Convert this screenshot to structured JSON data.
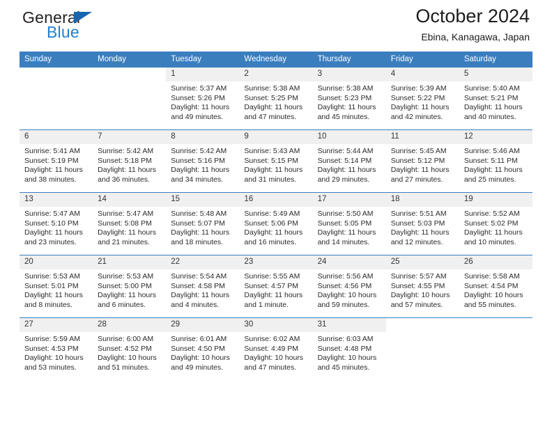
{
  "brand": {
    "name_top": "General",
    "name_bottom": "Blue",
    "triangle_color": "#1565b0",
    "blue_color": "#2081d2"
  },
  "header": {
    "title": "October 2024",
    "subtitle": "Ebina, Kanagawa, Japan"
  },
  "colors": {
    "header_row": "#3a7ebe",
    "day_band": "#f0f0f0",
    "text": "#2a2a2a"
  },
  "calendar": {
    "weekday_headers": [
      "Sunday",
      "Monday",
      "Tuesday",
      "Wednesday",
      "Thursday",
      "Friday",
      "Saturday"
    ],
    "labels": {
      "sunrise": "Sunrise:",
      "sunset": "Sunset:",
      "daylight": "Daylight:"
    },
    "weeks": [
      [
        {
          "day": "",
          "sunrise": "",
          "sunset": "",
          "daylight_line1": "",
          "daylight_line2": ""
        },
        {
          "day": "",
          "sunrise": "",
          "sunset": "",
          "daylight_line1": "",
          "daylight_line2": ""
        },
        {
          "day": "1",
          "sunrise": "Sunrise: 5:37 AM",
          "sunset": "Sunset: 5:26 PM",
          "daylight_line1": "Daylight: 11 hours",
          "daylight_line2": "and 49 minutes."
        },
        {
          "day": "2",
          "sunrise": "Sunrise: 5:38 AM",
          "sunset": "Sunset: 5:25 PM",
          "daylight_line1": "Daylight: 11 hours",
          "daylight_line2": "and 47 minutes."
        },
        {
          "day": "3",
          "sunrise": "Sunrise: 5:38 AM",
          "sunset": "Sunset: 5:23 PM",
          "daylight_line1": "Daylight: 11 hours",
          "daylight_line2": "and 45 minutes."
        },
        {
          "day": "4",
          "sunrise": "Sunrise: 5:39 AM",
          "sunset": "Sunset: 5:22 PM",
          "daylight_line1": "Daylight: 11 hours",
          "daylight_line2": "and 42 minutes."
        },
        {
          "day": "5",
          "sunrise": "Sunrise: 5:40 AM",
          "sunset": "Sunset: 5:21 PM",
          "daylight_line1": "Daylight: 11 hours",
          "daylight_line2": "and 40 minutes."
        }
      ],
      [
        {
          "day": "6",
          "sunrise": "Sunrise: 5:41 AM",
          "sunset": "Sunset: 5:19 PM",
          "daylight_line1": "Daylight: 11 hours",
          "daylight_line2": "and 38 minutes."
        },
        {
          "day": "7",
          "sunrise": "Sunrise: 5:42 AM",
          "sunset": "Sunset: 5:18 PM",
          "daylight_line1": "Daylight: 11 hours",
          "daylight_line2": "and 36 minutes."
        },
        {
          "day": "8",
          "sunrise": "Sunrise: 5:42 AM",
          "sunset": "Sunset: 5:16 PM",
          "daylight_line1": "Daylight: 11 hours",
          "daylight_line2": "and 34 minutes."
        },
        {
          "day": "9",
          "sunrise": "Sunrise: 5:43 AM",
          "sunset": "Sunset: 5:15 PM",
          "daylight_line1": "Daylight: 11 hours",
          "daylight_line2": "and 31 minutes."
        },
        {
          "day": "10",
          "sunrise": "Sunrise: 5:44 AM",
          "sunset": "Sunset: 5:14 PM",
          "daylight_line1": "Daylight: 11 hours",
          "daylight_line2": "and 29 minutes."
        },
        {
          "day": "11",
          "sunrise": "Sunrise: 5:45 AM",
          "sunset": "Sunset: 5:12 PM",
          "daylight_line1": "Daylight: 11 hours",
          "daylight_line2": "and 27 minutes."
        },
        {
          "day": "12",
          "sunrise": "Sunrise: 5:46 AM",
          "sunset": "Sunset: 5:11 PM",
          "daylight_line1": "Daylight: 11 hours",
          "daylight_line2": "and 25 minutes."
        }
      ],
      [
        {
          "day": "13",
          "sunrise": "Sunrise: 5:47 AM",
          "sunset": "Sunset: 5:10 PM",
          "daylight_line1": "Daylight: 11 hours",
          "daylight_line2": "and 23 minutes."
        },
        {
          "day": "14",
          "sunrise": "Sunrise: 5:47 AM",
          "sunset": "Sunset: 5:08 PM",
          "daylight_line1": "Daylight: 11 hours",
          "daylight_line2": "and 21 minutes."
        },
        {
          "day": "15",
          "sunrise": "Sunrise: 5:48 AM",
          "sunset": "Sunset: 5:07 PM",
          "daylight_line1": "Daylight: 11 hours",
          "daylight_line2": "and 18 minutes."
        },
        {
          "day": "16",
          "sunrise": "Sunrise: 5:49 AM",
          "sunset": "Sunset: 5:06 PM",
          "daylight_line1": "Daylight: 11 hours",
          "daylight_line2": "and 16 minutes."
        },
        {
          "day": "17",
          "sunrise": "Sunrise: 5:50 AM",
          "sunset": "Sunset: 5:05 PM",
          "daylight_line1": "Daylight: 11 hours",
          "daylight_line2": "and 14 minutes."
        },
        {
          "day": "18",
          "sunrise": "Sunrise: 5:51 AM",
          "sunset": "Sunset: 5:03 PM",
          "daylight_line1": "Daylight: 11 hours",
          "daylight_line2": "and 12 minutes."
        },
        {
          "day": "19",
          "sunrise": "Sunrise: 5:52 AM",
          "sunset": "Sunset: 5:02 PM",
          "daylight_line1": "Daylight: 11 hours",
          "daylight_line2": "and 10 minutes."
        }
      ],
      [
        {
          "day": "20",
          "sunrise": "Sunrise: 5:53 AM",
          "sunset": "Sunset: 5:01 PM",
          "daylight_line1": "Daylight: 11 hours",
          "daylight_line2": "and 8 minutes."
        },
        {
          "day": "21",
          "sunrise": "Sunrise: 5:53 AM",
          "sunset": "Sunset: 5:00 PM",
          "daylight_line1": "Daylight: 11 hours",
          "daylight_line2": "and 6 minutes."
        },
        {
          "day": "22",
          "sunrise": "Sunrise: 5:54 AM",
          "sunset": "Sunset: 4:58 PM",
          "daylight_line1": "Daylight: 11 hours",
          "daylight_line2": "and 4 minutes."
        },
        {
          "day": "23",
          "sunrise": "Sunrise: 5:55 AM",
          "sunset": "Sunset: 4:57 PM",
          "daylight_line1": "Daylight: 11 hours",
          "daylight_line2": "and 1 minute."
        },
        {
          "day": "24",
          "sunrise": "Sunrise: 5:56 AM",
          "sunset": "Sunset: 4:56 PM",
          "daylight_line1": "Daylight: 10 hours",
          "daylight_line2": "and 59 minutes."
        },
        {
          "day": "25",
          "sunrise": "Sunrise: 5:57 AM",
          "sunset": "Sunset: 4:55 PM",
          "daylight_line1": "Daylight: 10 hours",
          "daylight_line2": "and 57 minutes."
        },
        {
          "day": "26",
          "sunrise": "Sunrise: 5:58 AM",
          "sunset": "Sunset: 4:54 PM",
          "daylight_line1": "Daylight: 10 hours",
          "daylight_line2": "and 55 minutes."
        }
      ],
      [
        {
          "day": "27",
          "sunrise": "Sunrise: 5:59 AM",
          "sunset": "Sunset: 4:53 PM",
          "daylight_line1": "Daylight: 10 hours",
          "daylight_line2": "and 53 minutes."
        },
        {
          "day": "28",
          "sunrise": "Sunrise: 6:00 AM",
          "sunset": "Sunset: 4:52 PM",
          "daylight_line1": "Daylight: 10 hours",
          "daylight_line2": "and 51 minutes."
        },
        {
          "day": "29",
          "sunrise": "Sunrise: 6:01 AM",
          "sunset": "Sunset: 4:50 PM",
          "daylight_line1": "Daylight: 10 hours",
          "daylight_line2": "and 49 minutes."
        },
        {
          "day": "30",
          "sunrise": "Sunrise: 6:02 AM",
          "sunset": "Sunset: 4:49 PM",
          "daylight_line1": "Daylight: 10 hours",
          "daylight_line2": "and 47 minutes."
        },
        {
          "day": "31",
          "sunrise": "Sunrise: 6:03 AM",
          "sunset": "Sunset: 4:48 PM",
          "daylight_line1": "Daylight: 10 hours",
          "daylight_line2": "and 45 minutes."
        },
        {
          "day": "",
          "sunrise": "",
          "sunset": "",
          "daylight_line1": "",
          "daylight_line2": ""
        },
        {
          "day": "",
          "sunrise": "",
          "sunset": "",
          "daylight_line1": "",
          "daylight_line2": ""
        }
      ]
    ]
  }
}
